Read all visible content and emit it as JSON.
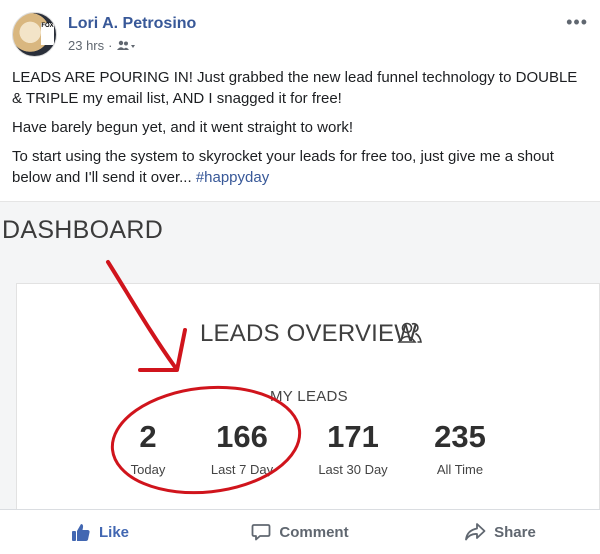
{
  "post": {
    "author": "Lori A. Petrosino",
    "time": "23 hrs",
    "separator": "·",
    "avatar_badge": "FOX",
    "more": "•••",
    "paragraphs": [
      "LEADS ARE POURING IN! Just grabbed the new lead funnel technology to DOUBLE & TRIPLE my email list, AND I snagged it for free!",
      "Have barely begun yet, and it went straight to work!",
      "To start using the system to skyrocket your leads for free too, just give me a shout below and I'll send it over..."
    ],
    "hashtag": "#happyday"
  },
  "dashboard": {
    "title": "DASHBOARD",
    "overview_title": "LEADS OVERVIEW",
    "section_label": "MY LEADS",
    "stats": [
      {
        "value": "2",
        "label": "Today"
      },
      {
        "value": "166",
        "label": "Last 7 Day"
      },
      {
        "value": "171",
        "label": "Last 30 Day"
      },
      {
        "value": "235",
        "label": "All Time"
      }
    ],
    "annotation_color": "#d0141c"
  },
  "actions": {
    "like": "Like",
    "comment": "Comment",
    "share": "Share"
  },
  "colors": {
    "link": "#385898",
    "like": "#4267b2",
    "muted": "#606770"
  }
}
